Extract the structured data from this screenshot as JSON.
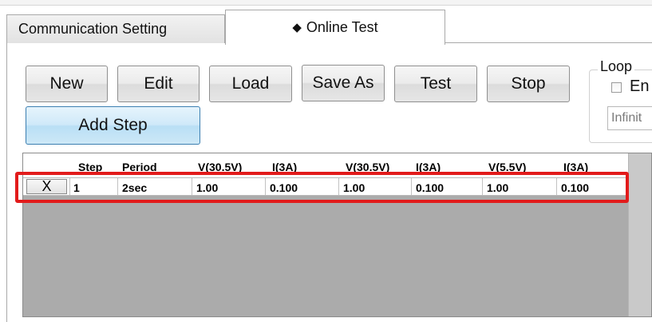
{
  "tabs": [
    {
      "label": "Communication Setting",
      "active": false
    },
    {
      "label": "Online Test",
      "active": true,
      "icon": "diamond-icon"
    }
  ],
  "toolbar": {
    "new_label": "New",
    "edit_label": "Edit",
    "load_label": "Load",
    "save_as_label": "Save As",
    "test_label": "Test",
    "stop_label": "Stop",
    "add_step_label": "Add Step"
  },
  "loop": {
    "title": "Loop",
    "enable_label": "En",
    "enable_checked": false,
    "count_value": "Infinit"
  },
  "grid": {
    "columns": [
      "Step",
      "Period",
      "V(30.5V)",
      "I(3A)",
      "V(30.5V)",
      "I(3A)",
      "V(5.5V)",
      "I(3A)"
    ],
    "rows": [
      {
        "delete_label": "X",
        "cells": [
          "1",
          "2sec",
          "1.00",
          "0.100",
          "1.00",
          "0.100",
          "1.00",
          "0.100"
        ]
      }
    ]
  },
  "colors": {
    "highlight": "#e21b1b",
    "add_step_button": "#b9dff5",
    "grid_background": "#ababab"
  }
}
